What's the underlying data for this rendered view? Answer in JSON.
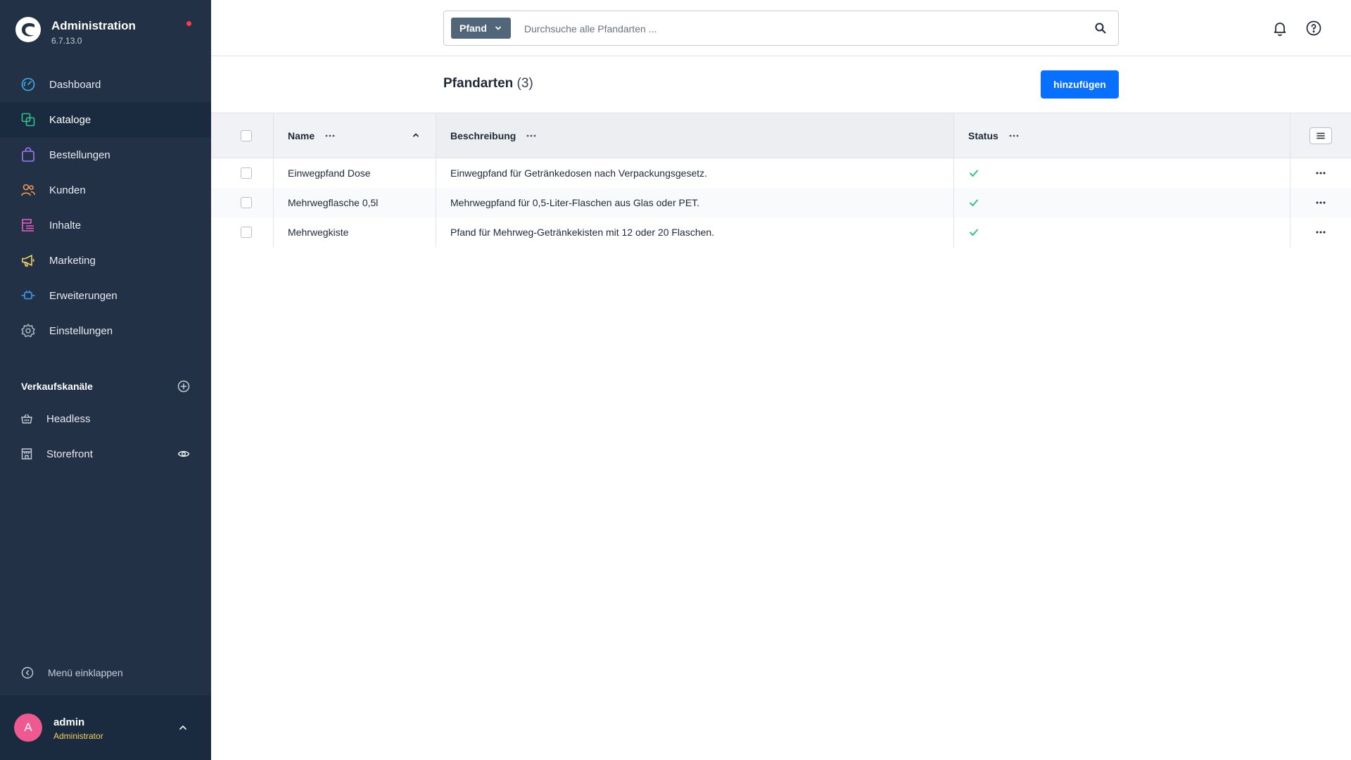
{
  "brand": {
    "title": "Administration",
    "version": "6.7.13.0"
  },
  "nav": [
    {
      "label": "Dashboard",
      "icon": "dashboard-icon",
      "color": "#38b2f0"
    },
    {
      "label": "Kataloge",
      "icon": "catalog-icon",
      "color": "#2fc68b",
      "active": true
    },
    {
      "label": "Bestellungen",
      "icon": "orders-icon",
      "color": "#a07cf0"
    },
    {
      "label": "Kunden",
      "icon": "customers-icon",
      "color": "#f59a52"
    },
    {
      "label": "Inhalte",
      "icon": "content-icon",
      "color": "#ee5fc6"
    },
    {
      "label": "Marketing",
      "icon": "marketing-icon",
      "color": "#f4d35e"
    },
    {
      "label": "Erweiterungen",
      "icon": "extensions-icon",
      "color": "#3b9cf4"
    },
    {
      "label": "Einstellungen",
      "icon": "settings-icon",
      "color": "#a8b2c0"
    }
  ],
  "sales_channels": {
    "title": "Verkaufskanäle",
    "items": [
      {
        "label": "Headless",
        "icon": "basket-icon"
      },
      {
        "label": "Storefront",
        "icon": "storefront-icon"
      }
    ]
  },
  "collapse_label": "Menü einklappen",
  "user": {
    "initial": "A",
    "name": "admin",
    "role": "Administrator"
  },
  "search": {
    "type_label": "Pfand",
    "placeholder": "Durchsuche alle Pfandarten ..."
  },
  "page": {
    "title": "Pfandarten",
    "count": "(3)",
    "add_label": "hinzufügen"
  },
  "grid": {
    "columns": {
      "name": "Name",
      "description": "Beschreibung",
      "status": "Status"
    },
    "rows": [
      {
        "name": "Einwegpfand Dose",
        "description": "Einwegpfand für Getränkedosen nach Verpackungsgesetz.",
        "active": true
      },
      {
        "name": "Mehrwegflasche 0,5l",
        "description": "Mehrwegpfand für 0,5-Liter-Flaschen aus Glas oder PET.",
        "active": true
      },
      {
        "name": "Mehrwegkiste",
        "description": "Pfand für Mehrweg-Getränkekisten mit 12 oder 20 Flaschen.",
        "active": true
      }
    ]
  },
  "colors": {
    "sidebar": "#233146",
    "primary": "#0870ff",
    "success": "#2fc68b"
  }
}
